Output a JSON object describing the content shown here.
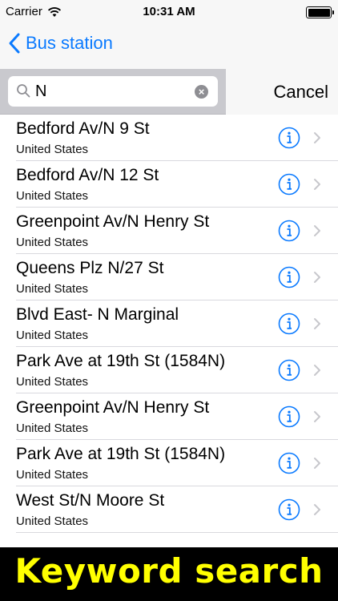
{
  "status_bar": {
    "carrier": "Carrier",
    "time": "10:31 AM"
  },
  "nav": {
    "back_label": "Bus station"
  },
  "search": {
    "query": "N",
    "clear_glyph": "×",
    "cancel_label": "Cancel"
  },
  "results": [
    {
      "title": "Bedford Av/N 9 St",
      "subtitle": "United States"
    },
    {
      "title": "Bedford Av/N 12 St",
      "subtitle": "United States"
    },
    {
      "title": "Greenpoint Av/N Henry St",
      "subtitle": "United States"
    },
    {
      "title": "Queens Plz N/27 St",
      "subtitle": "United States"
    },
    {
      "title": "Blvd East- N Marginal",
      "subtitle": "United States"
    },
    {
      "title": "Park Ave at 19th St (1584N)",
      "subtitle": "United States"
    },
    {
      "title": "Greenpoint Av/N Henry St",
      "subtitle": "United States"
    },
    {
      "title": "Park Ave at 19th St (1584N)",
      "subtitle": "United States"
    },
    {
      "title": "West St/N Moore St",
      "subtitle": "United States"
    }
  ],
  "banner": {
    "text": "Keyword search"
  },
  "colors": {
    "accent": "#0a7aff",
    "banner_bg": "#000000",
    "banner_text": "#ffff00"
  },
  "icons": [
    "chevron-left-icon",
    "search-icon",
    "clear-icon",
    "info-icon",
    "chevron-right-icon",
    "wifi-icon",
    "battery-icon"
  ]
}
